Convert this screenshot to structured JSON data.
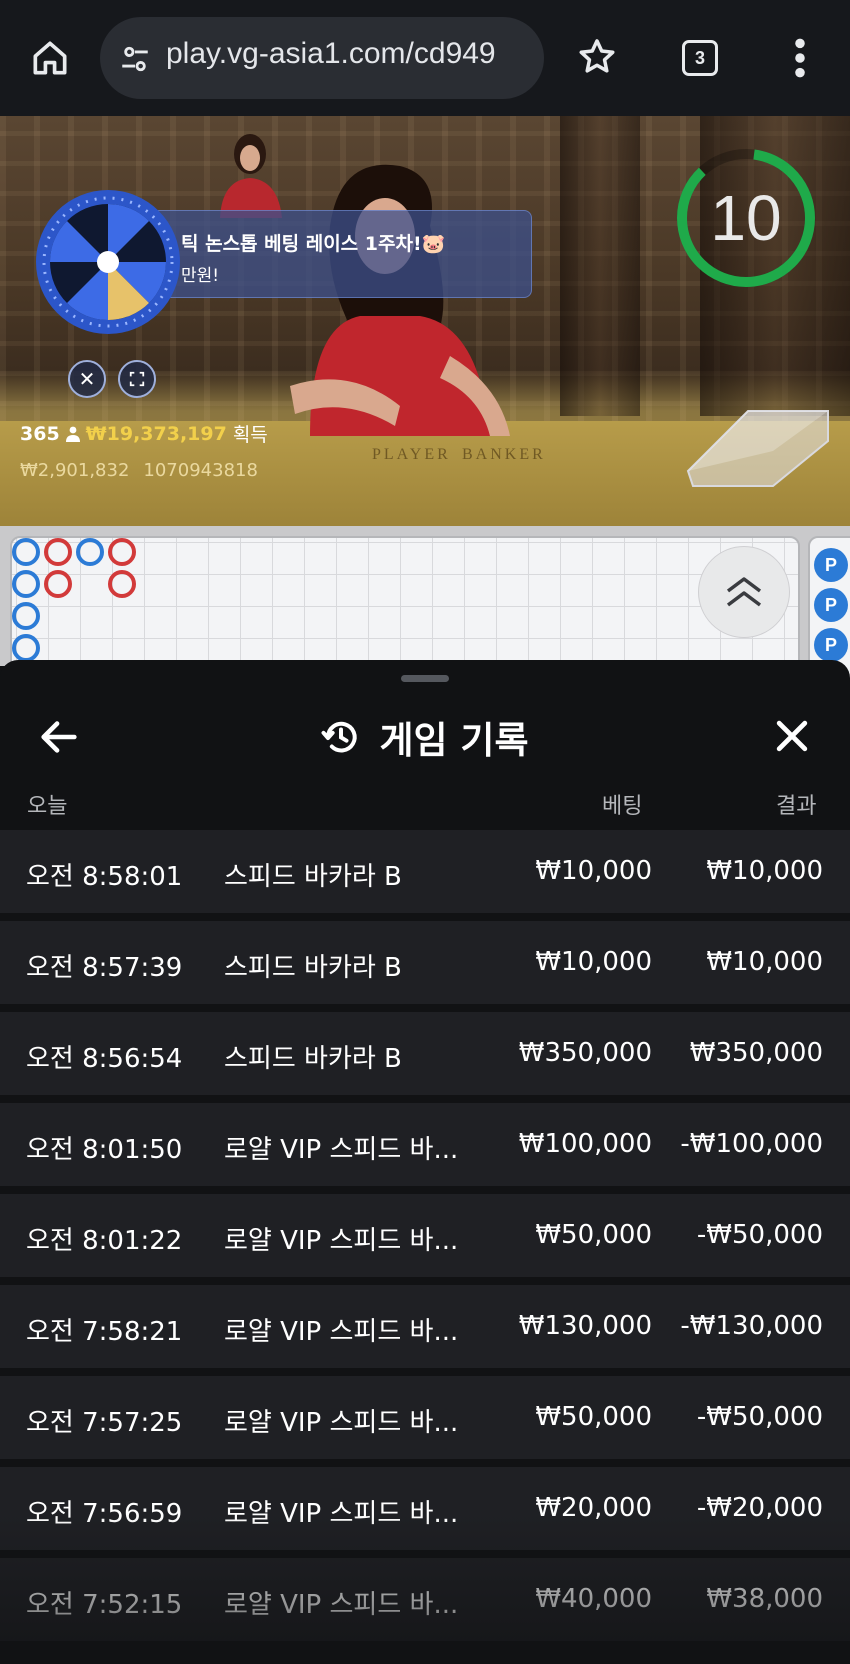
{
  "browser": {
    "url": "play.vg-asia1.com/cd949",
    "tab_count": "3"
  },
  "video": {
    "promo_title": "틱 논스톱 베팅 레이스 1주차!🐷",
    "promo_subtitle": "만원!",
    "winners_count": "365",
    "winners_amount": "₩19,373,197",
    "winners_suffix": "획득",
    "stat_amount": "₩2,901,832",
    "stat_id": "1070943818",
    "felt_player": "PLAYER",
    "felt_banker": "BANKER",
    "timer": "10"
  },
  "roadmap": {
    "side_label": "P"
  },
  "sheet": {
    "title": "게임 기록",
    "col_today": "오늘",
    "col_bet": "베팅",
    "col_result": "결과",
    "rows": [
      {
        "time": "오전 8:58:01",
        "game": "스피드 바카라 B",
        "bet": "₩10,000",
        "result": "₩10,000"
      },
      {
        "time": "오전 8:57:39",
        "game": "스피드 바카라 B",
        "bet": "₩10,000",
        "result": "₩10,000"
      },
      {
        "time": "오전 8:56:54",
        "game": "스피드 바카라 B",
        "bet": "₩350,000",
        "result": "₩350,000"
      },
      {
        "time": "오전 8:01:50",
        "game": "로얄 VIP 스피드 바...",
        "bet": "₩100,000",
        "result": "-₩100,000"
      },
      {
        "time": "오전 8:01:22",
        "game": "로얄 VIP 스피드 바...",
        "bet": "₩50,000",
        "result": "-₩50,000"
      },
      {
        "time": "오전 7:58:21",
        "game": "로얄 VIP 스피드 바...",
        "bet": "₩130,000",
        "result": "-₩130,000"
      },
      {
        "time": "오전 7:57:25",
        "game": "로얄 VIP 스피드 바...",
        "bet": "₩50,000",
        "result": "-₩50,000"
      },
      {
        "time": "오전 7:56:59",
        "game": "로얄 VIP 스피드 바...",
        "bet": "₩20,000",
        "result": "-₩20,000"
      },
      {
        "time": "오전 7:52:15",
        "game": "로얄 VIP 스피드 바...",
        "bet": "₩40,000",
        "result": "₩38,000"
      }
    ]
  },
  "colors": {
    "timer_ring": "#1faa4a",
    "winner_amount": "#f2d04b",
    "banker_red": "#d23a3a",
    "player_blue": "#2c7bd6"
  }
}
